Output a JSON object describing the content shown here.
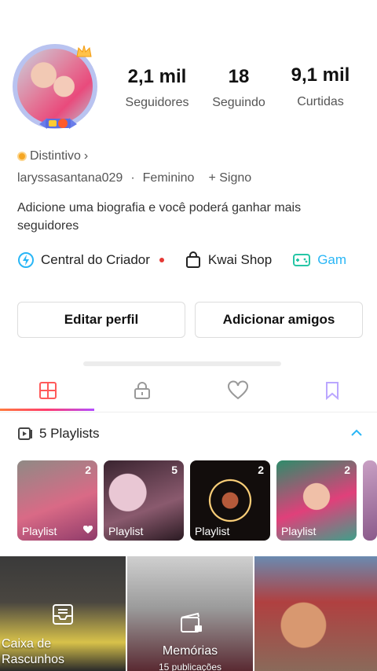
{
  "profile": {
    "stats": [
      {
        "value": "2,1 mil",
        "label": "Seguidores"
      },
      {
        "value": "18",
        "label": "Seguindo"
      },
      {
        "value": "9,1 mil",
        "label": "Curtidas"
      }
    ],
    "badge_label": "Distintivo",
    "badge_chevron": "›",
    "username": "laryssasantana029",
    "separator": "·",
    "gender": "Feminino",
    "sign": "+ Signo",
    "bio_prompt": "Adicione uma biografia e você poderá ganhar mais seguidores"
  },
  "shortcuts": {
    "creator_center": "Central do Criador",
    "kwai_shop": "Kwai Shop",
    "games": "Gam"
  },
  "buttons": {
    "edit_profile": "Editar perfil",
    "add_friends": "Adicionar amigos"
  },
  "playlists": {
    "header": "5 Playlists",
    "items": [
      {
        "label": "Playlist",
        "count": "2"
      },
      {
        "label": "Playlist",
        "count": "5"
      },
      {
        "label": "Playlist",
        "count": "2"
      },
      {
        "label": "Playlist",
        "count": "2"
      }
    ]
  },
  "grid": {
    "drafts_label": "Caixa de Rascunhos",
    "memories_label": "Memórias",
    "memories_count": "15 publicações"
  },
  "colors": {
    "accent_gradient_start": "#ff7a3d",
    "accent_gradient_end": "#b44dff",
    "notification_dot": "#e53935",
    "badge_gold": "#f5a623"
  }
}
